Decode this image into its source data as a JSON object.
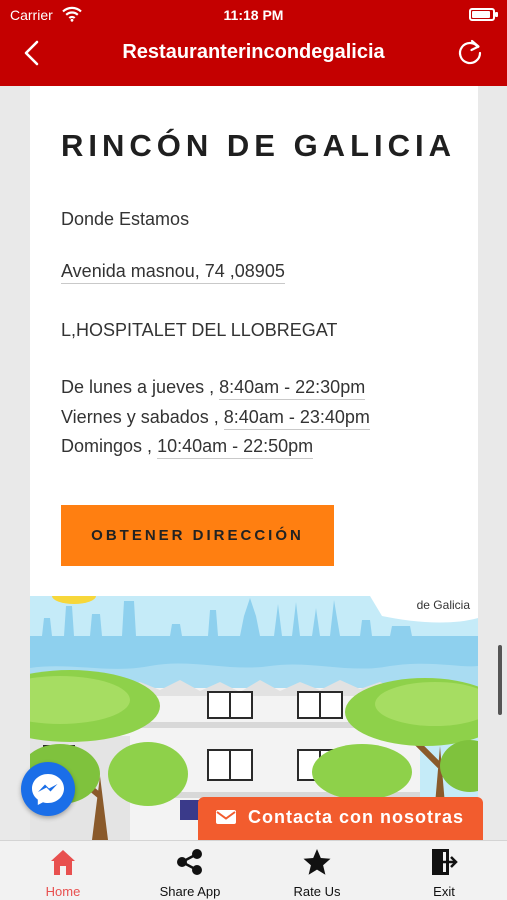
{
  "status_bar": {
    "carrier": "Carrier",
    "time": "11:18 PM"
  },
  "nav": {
    "title": "Restauranterincondegalicia"
  },
  "content": {
    "heading": "RINCÓN DE GALICIA",
    "where_label": "Donde Estamos",
    "address": "Avenida masnou, 74 ,08905",
    "city": "L,HOSPITALET DEL LLOBREGAT",
    "hours": [
      {
        "days": "De lunes a jueves ,",
        "time": "8:40am - 22:30pm"
      },
      {
        "days": "Viernes y sabados ,",
        "time": "8:40am - 23:40pm"
      },
      {
        "days": "Domingos ,",
        "time": "10:40am - 22:50pm"
      }
    ],
    "cta_label": "OBTENER DIRECCIÓN"
  },
  "illustration": {
    "brand_text": "de Galicia"
  },
  "contact": {
    "label": "Contacta con nosotras"
  },
  "tabs": [
    {
      "label": "Home",
      "icon": "home-icon",
      "active": true
    },
    {
      "label": "Share App",
      "icon": "share-icon",
      "active": false
    },
    {
      "label": "Rate Us",
      "icon": "star-icon",
      "active": false
    },
    {
      "label": "Exit",
      "icon": "exit-icon",
      "active": false
    }
  ],
  "colors": {
    "nav_red": "#c40000",
    "cta_orange": "#ff7f11",
    "contact_orange": "#f25c2e",
    "active_tab": "#e8504f",
    "messenger_blue": "#1a6ee8"
  }
}
